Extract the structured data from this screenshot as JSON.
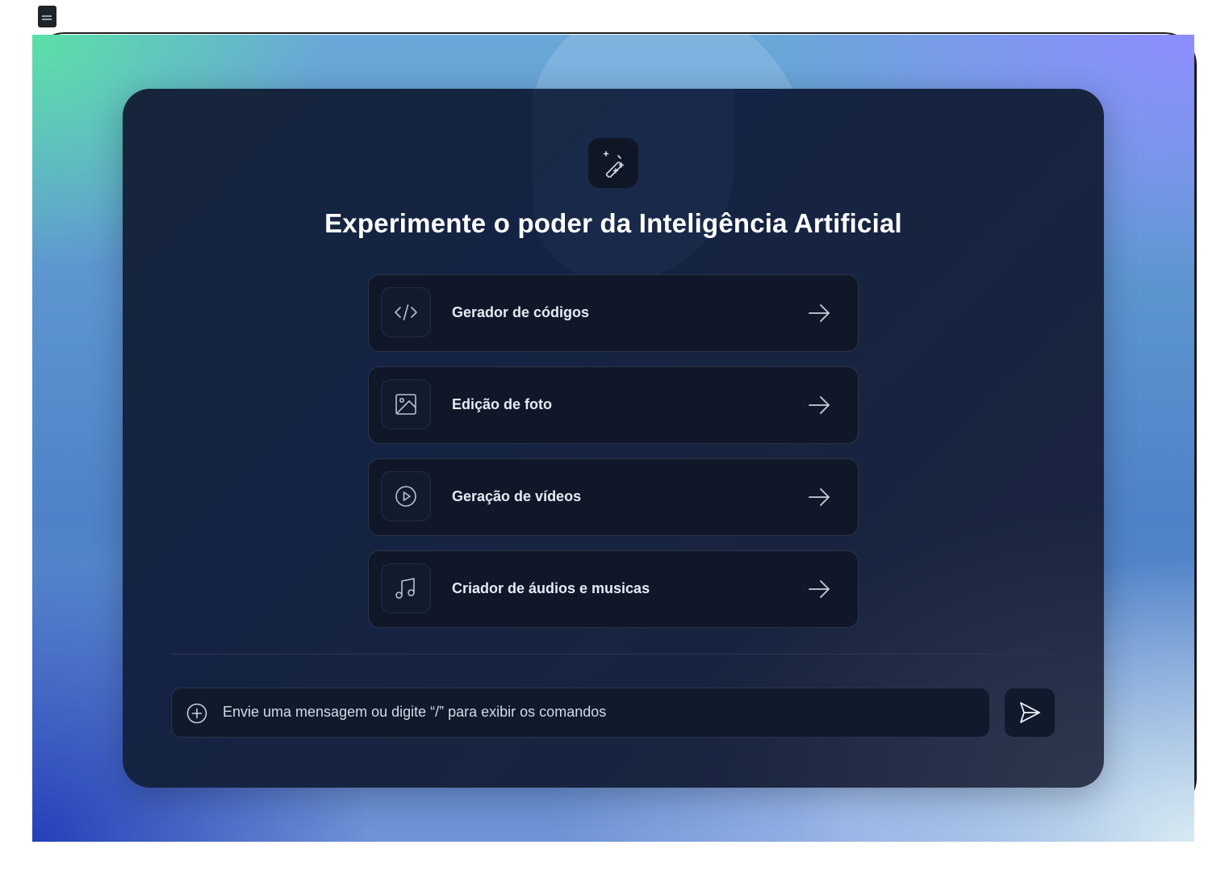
{
  "app": {
    "title": "Experimente o poder da Inteligência Artificial",
    "logo_icon": "magic-wand-sparkles-icon"
  },
  "features": [
    {
      "label": "Gerador de códigos",
      "icon": "code-icon"
    },
    {
      "label": "Edição de foto",
      "icon": "image-icon"
    },
    {
      "label": "Geração de vídeos",
      "icon": "play-circle-icon"
    },
    {
      "label": "Criador de áudios e musicas",
      "icon": "music-note-icon"
    }
  ],
  "composer": {
    "placeholder": "Envie uma mensagem ou digite “/” para exibir os comandos",
    "add_icon": "plus-circle-icon",
    "send_icon": "send-icon"
  },
  "colors": {
    "panel_bg": "#142344",
    "card_bg": "#0f1729",
    "text": "#e6ebf3"
  }
}
